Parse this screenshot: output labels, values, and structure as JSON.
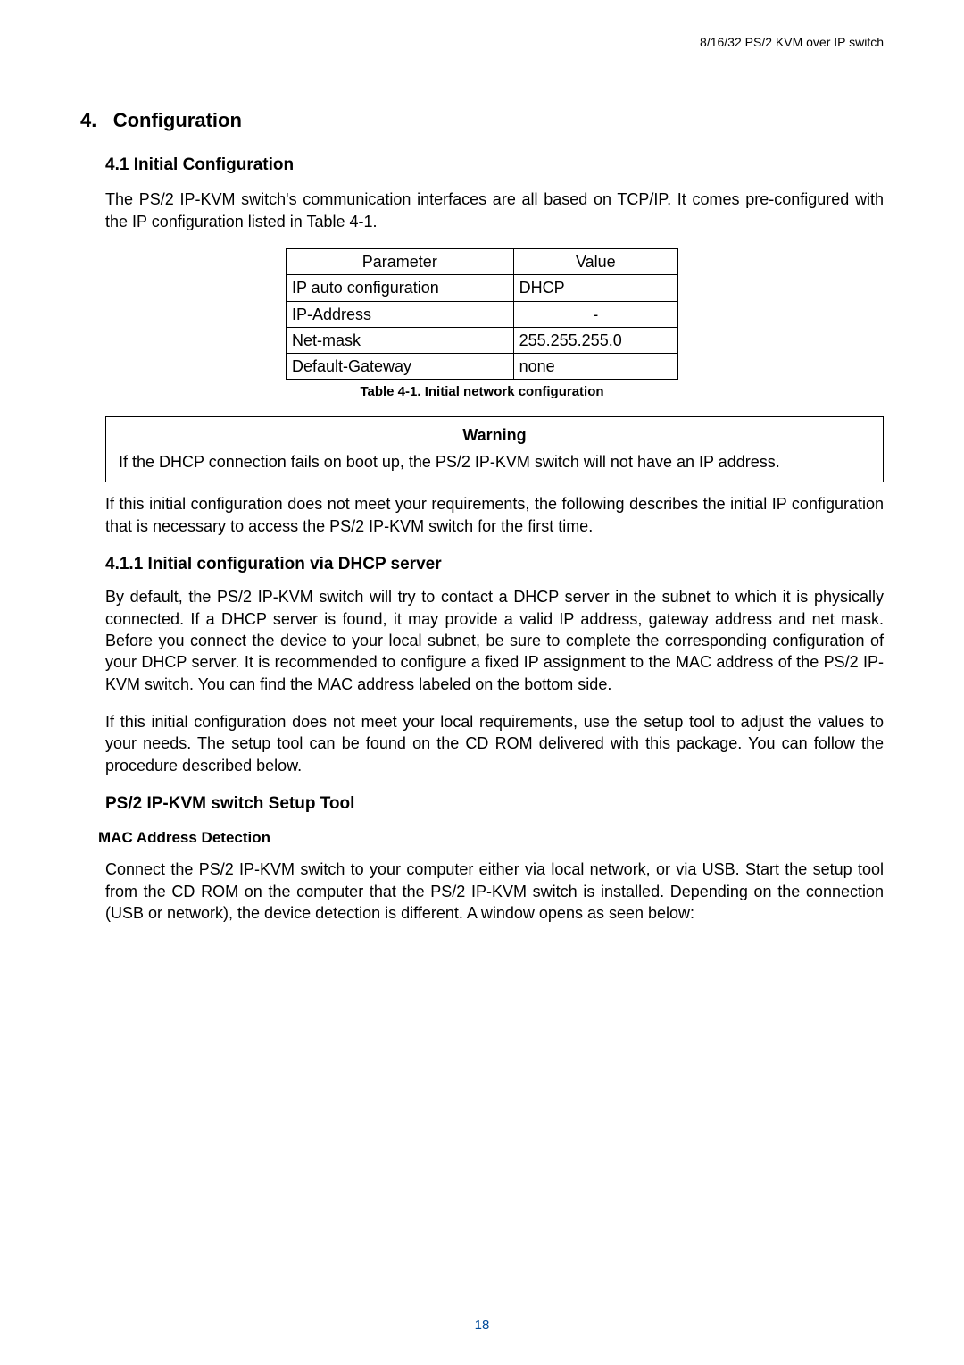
{
  "header": {
    "doc_title": "8/16/32 PS/2 KVM over IP switch"
  },
  "section": {
    "number": "4.",
    "title": "Configuration"
  },
  "sub41": {
    "heading": "4.1 Initial Configuration",
    "para1": "The PS/2 IP-KVM switch's communication interfaces are all based on TCP/IP. It comes pre-configured with the IP configuration listed in Table 4-1."
  },
  "table41": {
    "head_param": "Parameter",
    "head_value": "Value",
    "rows": [
      {
        "param": "IP auto configuration",
        "value": "DHCP"
      },
      {
        "param": "IP-Address",
        "value": "-"
      },
      {
        "param": "Net-mask",
        "value": "255.255.255.0"
      },
      {
        "param": "Default-Gateway",
        "value": "none"
      }
    ],
    "caption": "Table 4-1. Initial network configuration"
  },
  "warning": {
    "title": "Warning",
    "text": "If the DHCP connection fails on boot up, the PS/2 IP-KVM switch will not have an IP address."
  },
  "after_warning_para": "If this initial configuration does not meet your requirements, the following describes the initial IP configuration that is necessary to access the PS/2 IP-KVM switch for the first time.",
  "sub411": {
    "heading": "4.1.1  Initial configuration via DHCP server",
    "para1": "By default, the PS/2 IP-KVM switch will try to contact a DHCP server in the subnet to which it is physically connected. If a DHCP server is found, it may provide a valid IP address, gateway address and net mask. Before you connect the device to your local subnet, be sure to complete the corresponding configuration of your DHCP server. It is recommended to configure a fixed IP assignment to the MAC address of the PS/2 IP-KVM switch. You can find the MAC address labeled on the bottom side.",
    "para2": "If this initial configuration does not meet your local requirements, use the setup tool to adjust the values to your needs. The setup tool can be found on the CD ROM delivered with this package. You can follow the procedure described below."
  },
  "tool": {
    "heading": "PS/2 IP-KVM switch Setup Tool",
    "mac_heading": "MAC Address Detection",
    "mac_para": "Connect the PS/2 IP-KVM switch to your computer either via local network, or via USB. Start the setup tool from the CD ROM on the computer that the PS/2 IP-KVM switch is installed. Depending on the connection (USB or network), the device detection is different. A window opens as seen below:"
  },
  "footer": {
    "page": "18"
  }
}
